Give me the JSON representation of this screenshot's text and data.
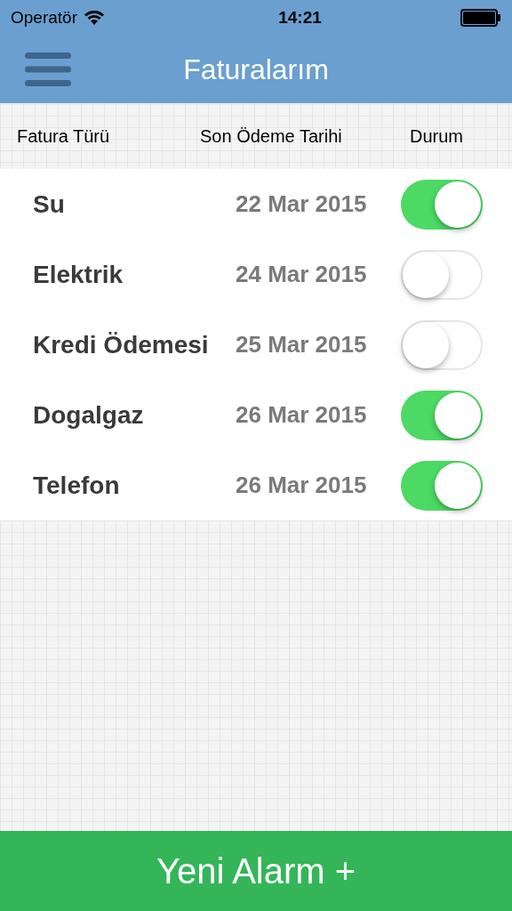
{
  "status_bar": {
    "carrier": "Operatör",
    "time": "14:21"
  },
  "nav_bar": {
    "title": "Faturalarım"
  },
  "table": {
    "columns": [
      "Fatura Türü",
      "Son Ödeme Tarihi",
      "Durum"
    ],
    "rows": [
      {
        "name": "Su",
        "date": "22 Mar 2015",
        "on": true
      },
      {
        "name": "Elektrik",
        "date": "24 Mar 2015",
        "on": false
      },
      {
        "name": "Kredi Ödemesi",
        "date": "25 Mar 2015",
        "on": false
      },
      {
        "name": "Dogalgaz",
        "date": "26 Mar 2015",
        "on": true
      },
      {
        "name": "Telefon",
        "date": "26 Mar 2015",
        "on": true
      }
    ]
  },
  "footer_button": {
    "label": "Yeni Alarm +"
  }
}
